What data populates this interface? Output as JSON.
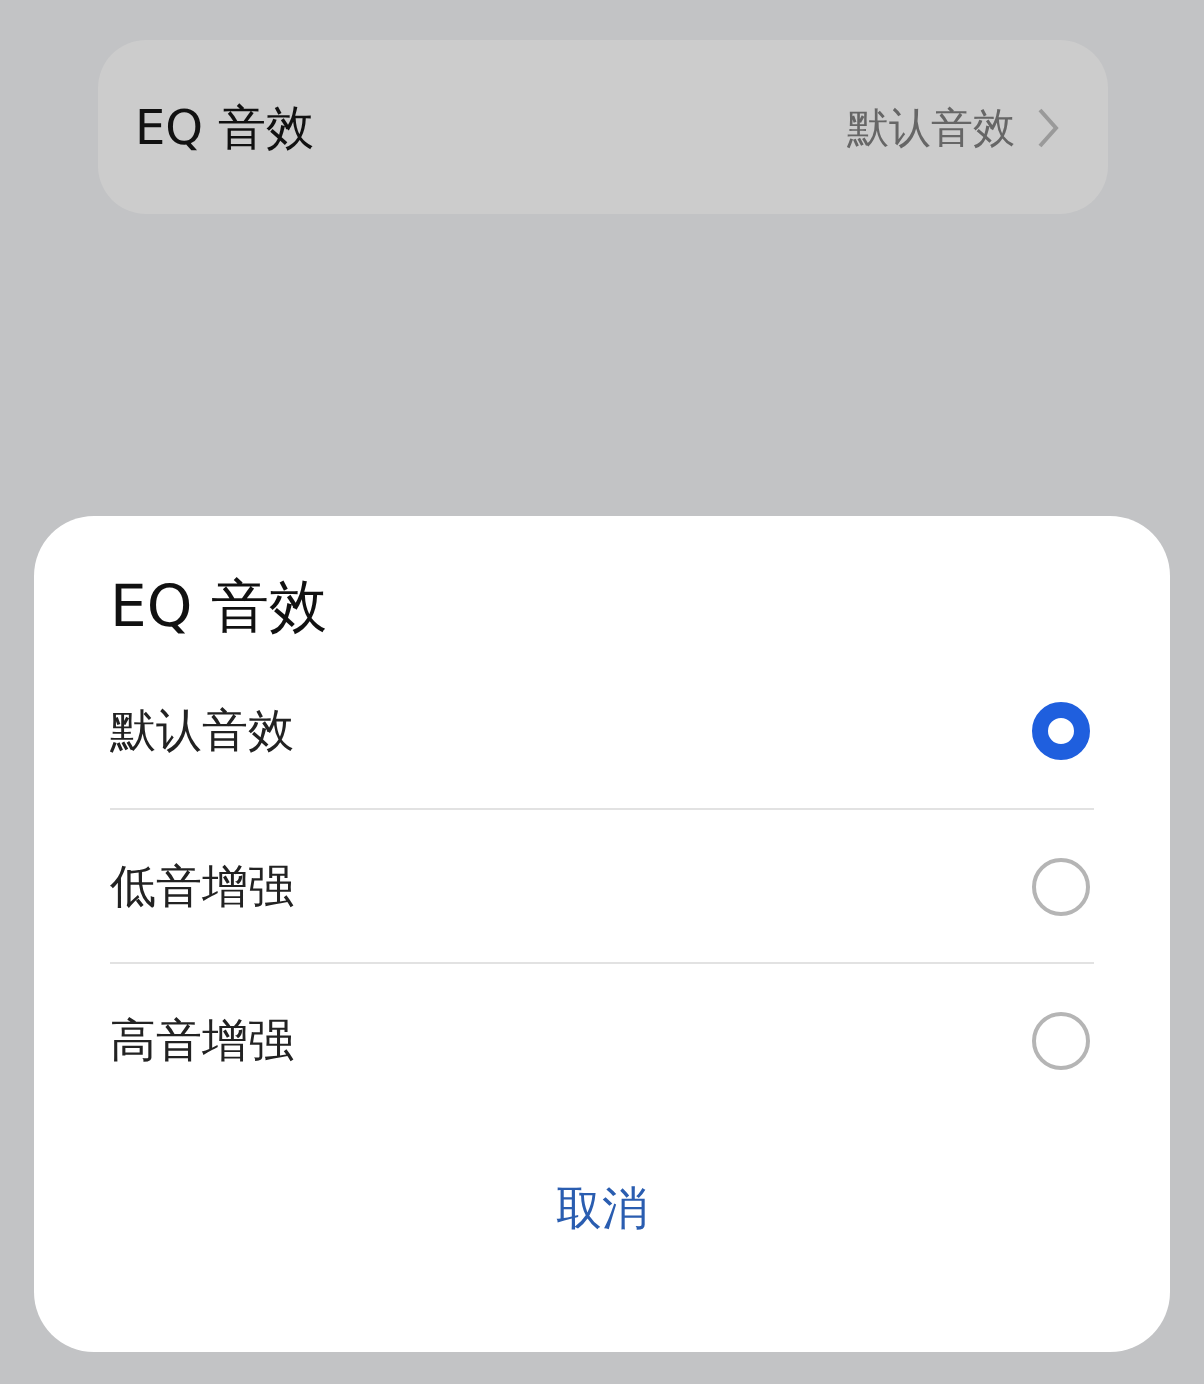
{
  "setting_row": {
    "label": "EQ 音效",
    "value": "默认音效"
  },
  "dialog": {
    "title": "EQ 音效",
    "options": [
      {
        "label": "默认音效",
        "selected": true
      },
      {
        "label": "低音增强",
        "selected": false
      },
      {
        "label": "高音增强",
        "selected": false
      }
    ],
    "cancel": "取消"
  }
}
